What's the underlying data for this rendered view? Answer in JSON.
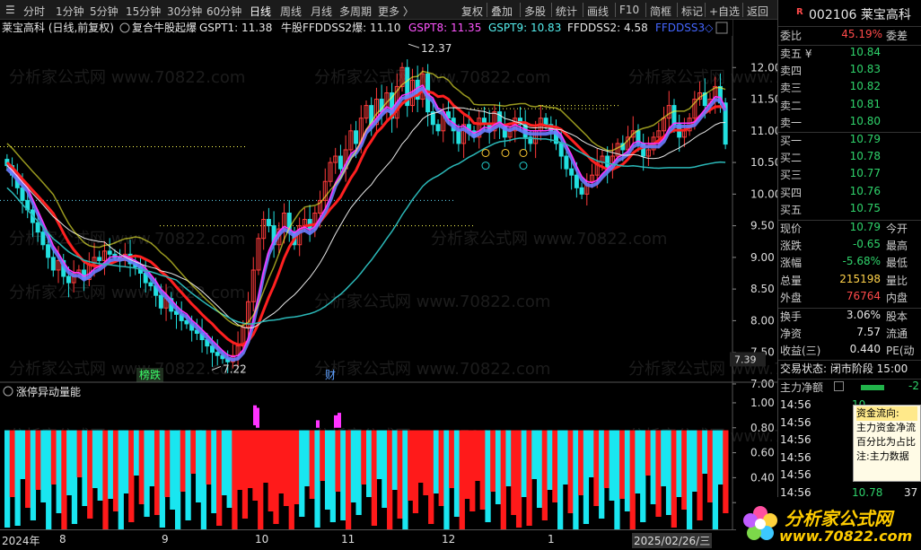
{
  "toolbar": {
    "items": [
      "分时",
      "1分钟",
      "5分钟",
      "15分钟",
      "30分钟",
      "60分钟",
      "日线",
      "周线",
      "月线",
      "多周期",
      "更多 〉"
    ],
    "right_items": [
      "复权",
      "叠加",
      "多股",
      "统计",
      "画线",
      "F10",
      "简框",
      "标记",
      "+自选",
      "返回"
    ],
    "active": "日线"
  },
  "chart": {
    "legend_name": "莱宝高科 (日线,前复权)",
    "indicator_name": "复合牛股起爆",
    "gspt1": "GSPT1: 11.38",
    "niugu": "牛股FFDDSS2爆: 11.10",
    "gspt8": "GSPT8: 11.35",
    "gspt9": "GSPT9: 10.83",
    "ffddss2": "FFDDSS2: 4.58",
    "ffddss3": "FFDDSS3◇",
    "high_label": "12.37",
    "low_label": "7.22",
    "price_tag": "7.39",
    "y_ticks": [
      "12.00",
      "11.50",
      "11.00",
      "10.50",
      "10.00",
      "9.50",
      "9.00",
      "8.50",
      "8.00",
      "7.50",
      "7.00"
    ],
    "event_1": "榜跌",
    "event_2": "财",
    "watermark": "分析家公式网 www.70822.com",
    "sub_title": "涨停异动量能",
    "sub_ticks": [
      "1.00",
      "0.80",
      "0.60",
      "0.40",
      "0.20"
    ]
  },
  "date_axis": [
    "2024年",
    "8",
    "9",
    "10",
    "11",
    "12",
    "1",
    "2025/02/26/三"
  ],
  "sidebar": {
    "code_name": "002106 莱宝高科",
    "badge": "R",
    "weibi_label": "委比",
    "weibi_value": "45.19%",
    "weicha_label": "委差",
    "asks": [
      {
        "label": "卖五 ¥",
        "price": "10.84"
      },
      {
        "label": "卖四",
        "price": "10.83"
      },
      {
        "label": "卖三",
        "price": "10.82"
      },
      {
        "label": "卖二",
        "price": "10.81"
      },
      {
        "label": "卖一",
        "price": "10.80"
      }
    ],
    "bids": [
      {
        "label": "买一",
        "price": "10.79"
      },
      {
        "label": "买二",
        "price": "10.78"
      },
      {
        "label": "买三",
        "price": "10.77"
      },
      {
        "label": "买四",
        "price": "10.76"
      },
      {
        "label": "买五",
        "price": "10.75"
      }
    ],
    "stats": [
      {
        "l": "现价",
        "v": "10.79",
        "r": "今开",
        "c": "green"
      },
      {
        "l": "涨跌",
        "v": "-0.65",
        "r": "最高",
        "c": "green"
      },
      {
        "l": "涨幅",
        "v": "-5.68%",
        "r": "最低",
        "c": "green"
      },
      {
        "l": "总量",
        "v": "215198",
        "r": "量比",
        "c": "yellow"
      },
      {
        "l": "外盘",
        "v": "76764",
        "r": "内盘",
        "c": "red"
      }
    ],
    "stats2": [
      {
        "l": "换手",
        "v": "3.06%",
        "r": "股本"
      },
      {
        "l": "净资",
        "v": "7.57",
        "r": "流通"
      },
      {
        "l": "收益(三)",
        "v": "0.440",
        "r": "PE(动"
      }
    ],
    "trade_status": "交易状态: 闭市阶段 15:00",
    "main_flow": "主力净额",
    "main_flow_val": "-2",
    "ticks": [
      {
        "t": "14:56",
        "p": "10",
        "v": ""
      },
      {
        "t": "14:56",
        "p": "10",
        "v": ""
      },
      {
        "t": "14:56",
        "p": "10",
        "v": ""
      },
      {
        "t": "14:56",
        "p": "10",
        "v": ""
      },
      {
        "t": "14:56",
        "p": "10",
        "v": ""
      },
      {
        "t": "14:56",
        "p": "10.78",
        "v": "37"
      }
    ]
  },
  "tooltip": {
    "title": "资金流向:",
    "lines": [
      "主力资金净流",
      "百分比为占比",
      "注:主力数据"
    ]
  },
  "logo": {
    "line1": "分析家公式网",
    "line2": "www.70822.com"
  },
  "colors": {
    "up": "#ff3b3b",
    "down": "#22e0e0",
    "white_line": "#e8e8e8",
    "yellow_line": "#ffff33",
    "magenta": "#ff33ff",
    "blue": "#6a7cff",
    "cyan_line": "#2bb8b8",
    "red_band": "#ff2020"
  },
  "chart_data": {
    "type": "candlestick",
    "title": "莱宝高科 (日线,前复权)",
    "ylim": [
      6.9,
      12.5
    ],
    "y_ticks": [
      12.0,
      11.5,
      11.0,
      10.5,
      10.0,
      9.5,
      9.0,
      8.5,
      8.0,
      7.5,
      7.0
    ],
    "x_labels": [
      "2024年",
      "8",
      "9",
      "10",
      "11",
      "12",
      "1",
      "2025/02/26/三"
    ],
    "annotations": [
      {
        "text": "12.37",
        "value": 12.37
      },
      {
        "text": "7.22",
        "value": 7.22
      }
    ],
    "close": [
      10.45,
      10.3,
      10.1,
      9.9,
      9.75,
      9.55,
      9.4,
      9.2,
      9.0,
      8.8,
      8.95,
      8.7,
      8.6,
      8.75,
      8.8,
      8.65,
      8.9,
      9.0,
      8.95,
      9.1,
      9.05,
      9.0,
      8.95,
      9.05,
      8.9,
      8.85,
      8.75,
      8.6,
      8.55,
      8.4,
      8.2,
      8.35,
      8.15,
      8.1,
      8.0,
      7.95,
      7.85,
      7.8,
      7.7,
      7.6,
      7.5,
      7.45,
      7.4,
      7.35,
      7.45,
      7.6,
      7.9,
      8.3,
      8.8,
      9.3,
      9.6,
      9.5,
      9.2,
      9.45,
      9.7,
      9.4,
      9.2,
      9.5,
      9.6,
      9.45,
      9.7,
      9.9,
      10.2,
      10.5,
      10.6,
      10.4,
      10.7,
      11.0,
      10.8,
      11.2,
      11.4,
      11.1,
      11.5,
      11.3,
      11.6,
      11.2,
      11.7,
      12.0,
      11.4,
      11.8,
      11.5,
      11.9,
      11.3,
      11.1,
      11.0,
      11.3,
      11.2,
      11.0,
      10.8,
      11.1,
      11.0,
      10.9,
      11.2,
      11.1,
      11.0,
      11.3,
      11.1,
      10.9,
      11.0,
      11.2,
      11.1,
      10.9,
      10.8,
      11.0,
      11.2,
      11.1,
      11.0,
      10.8,
      10.6,
      10.4,
      10.3,
      10.1,
      10.0,
      10.2,
      10.3,
      10.5,
      10.6,
      10.4,
      10.6,
      10.8,
      10.7,
      10.9,
      11.0,
      10.8,
      10.6,
      10.7,
      10.9,
      11.0,
      11.2,
      11.4,
      11.1,
      10.9,
      11.0,
      11.2,
      11.5,
      11.6,
      11.4,
      11.5,
      11.7,
      11.44,
      10.79
    ],
    "volume_bars_note": "alternating red/cyan volume-energy bars with magenta spikes"
  }
}
